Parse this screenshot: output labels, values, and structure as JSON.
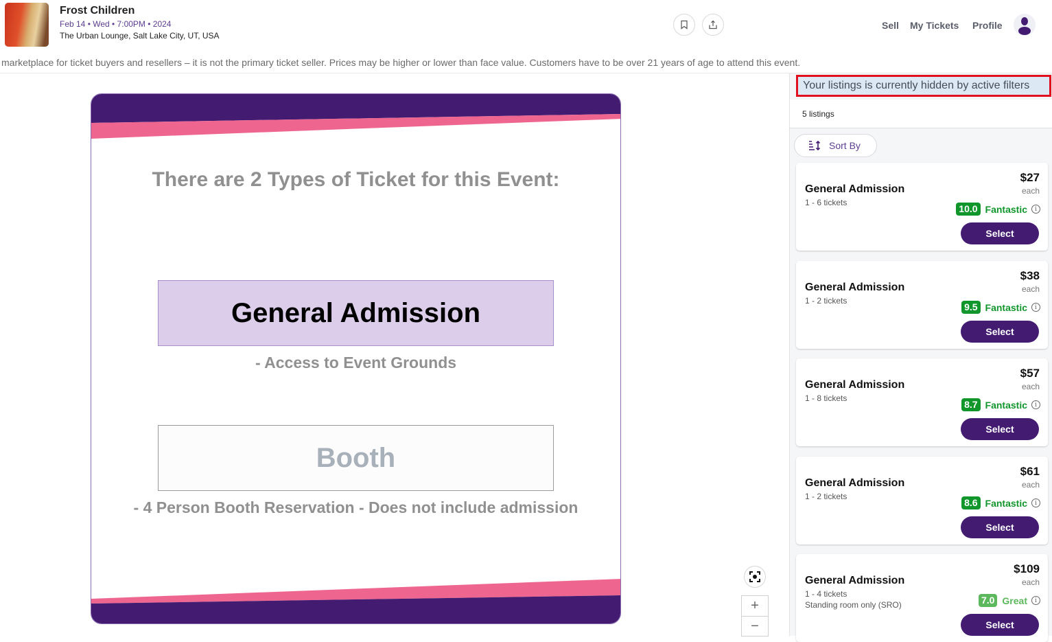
{
  "event": {
    "title": "Frost Children",
    "date_line": "Feb 14 • Wed • 7:00PM • 2024",
    "venue": "The Urban Lounge, Salt Lake City, UT, USA"
  },
  "nav": {
    "sell": "Sell",
    "my_tickets": "My Tickets",
    "profile": "Profile"
  },
  "disclaimer": "marketplace for ticket buyers and resellers – it is not the primary ticket seller. Prices may be higher or lower than face value. Customers have to be over 21 years of age to attend this event.",
  "map": {
    "heading": "There are 2 Types of Ticket for this Event:",
    "types": [
      {
        "name": "General Admission",
        "description": "- Access to Event Grounds"
      },
      {
        "name": "Booth",
        "description": "- 4 Person Booth Reservation - Does not include admission"
      }
    ],
    "zoom_in": "+",
    "zoom_out": "−"
  },
  "sidebar": {
    "filter_notice": "Your listings is currently hidden by active filters",
    "listing_count": "5 listings",
    "sort_label": "Sort By",
    "listings": [
      {
        "title": "General Admission",
        "qty": "1 - 6 tickets",
        "note": "",
        "price": "$27",
        "each": "each",
        "score": "10.0",
        "rating": "Fantastic",
        "score_color": "#11962c",
        "label_color": "#11962c",
        "select": "Select"
      },
      {
        "title": "General Admission",
        "qty": "1 - 2 tickets",
        "note": "",
        "price": "$38",
        "each": "each",
        "score": "9.5",
        "rating": "Fantastic",
        "score_color": "#11962c",
        "label_color": "#11962c",
        "select": "Select"
      },
      {
        "title": "General Admission",
        "qty": "1 - 8 tickets",
        "note": "",
        "price": "$57",
        "each": "each",
        "score": "8.7",
        "rating": "Fantastic",
        "score_color": "#11962c",
        "label_color": "#11962c",
        "select": "Select"
      },
      {
        "title": "General Admission",
        "qty": "1 - 2 tickets",
        "note": "",
        "price": "$61",
        "each": "each",
        "score": "8.6",
        "rating": "Fantastic",
        "score_color": "#11962c",
        "label_color": "#11962c",
        "select": "Select"
      },
      {
        "title": "General Admission",
        "qty": "1 - 4 tickets",
        "note": "Standing room only (SRO)",
        "price": "$109",
        "each": "each",
        "score": "7.0",
        "rating": "Great",
        "score_color": "#5cb85c",
        "label_color": "#5cb85c",
        "select": "Select"
      }
    ]
  },
  "colors": {
    "brand_purple": "#431c72",
    "accent_pink": "#ee6690",
    "alert_red": "#e0101e"
  }
}
